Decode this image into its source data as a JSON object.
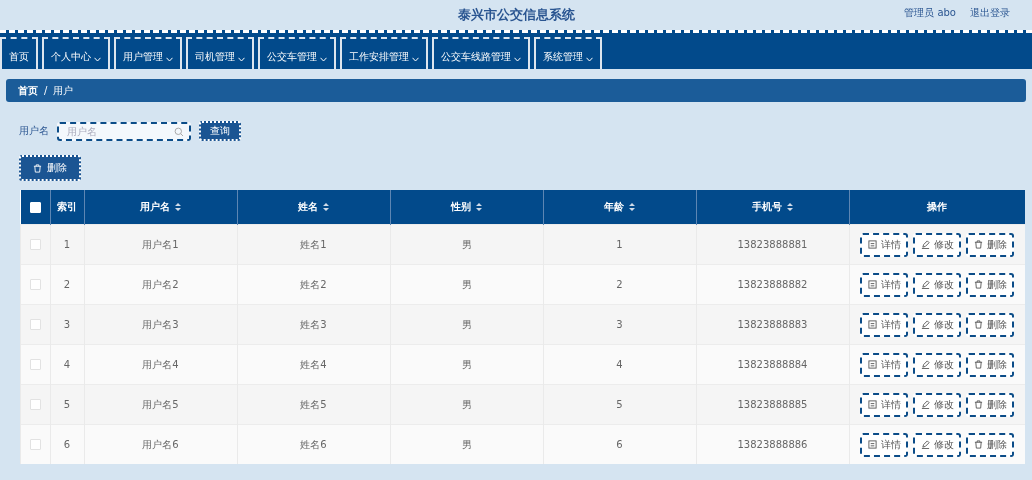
{
  "header": {
    "title": "泰兴市公交信息系统",
    "user": "管理员 abo",
    "logout": "退出登录"
  },
  "nav": [
    {
      "label": "首页",
      "dropdown": false
    },
    {
      "label": "个人中心",
      "dropdown": true
    },
    {
      "label": "用户管理",
      "dropdown": true
    },
    {
      "label": "司机管理",
      "dropdown": true
    },
    {
      "label": "公交车管理",
      "dropdown": true
    },
    {
      "label": "工作安排管理",
      "dropdown": true
    },
    {
      "label": "公交车线路管理",
      "dropdown": true
    },
    {
      "label": "系统管理",
      "dropdown": true
    }
  ],
  "breadcrumb": {
    "items": [
      "首页",
      "用户"
    ],
    "separator": "/"
  },
  "search": {
    "label": "用户名",
    "placeholder": "用户名",
    "button": "查询"
  },
  "delete_button": "删除",
  "table": {
    "select_all_checked": false,
    "columns": [
      {
        "label": "索引",
        "sortable": false
      },
      {
        "label": "用户名",
        "sortable": true
      },
      {
        "label": "姓名",
        "sortable": true
      },
      {
        "label": "性别",
        "sortable": true
      },
      {
        "label": "年龄",
        "sortable": true
      },
      {
        "label": "手机号",
        "sortable": true
      },
      {
        "label": "操作",
        "sortable": false
      }
    ],
    "rows": [
      {
        "checked": false,
        "cells": [
          "1",
          "用户名1",
          "姓名1",
          "男",
          "1",
          "13823888881"
        ],
        "actions": [
          "详情",
          "修改",
          "删除"
        ]
      },
      {
        "checked": false,
        "cells": [
          "2",
          "用户名2",
          "姓名2",
          "男",
          "2",
          "13823888882"
        ],
        "actions": [
          "详情",
          "修改",
          "删除"
        ]
      },
      {
        "checked": false,
        "cells": [
          "3",
          "用户名3",
          "姓名3",
          "男",
          "3",
          "13823888883"
        ],
        "actions": [
          "详情",
          "修改",
          "删除"
        ]
      },
      {
        "checked": false,
        "cells": [
          "4",
          "用户名4",
          "姓名4",
          "男",
          "4",
          "13823888884"
        ],
        "actions": [
          "详情",
          "修改",
          "删除"
        ]
      },
      {
        "checked": false,
        "cells": [
          "5",
          "用户名5",
          "姓名5",
          "男",
          "5",
          "13823888885"
        ],
        "actions": [
          "详情",
          "修改",
          "删除"
        ]
      },
      {
        "checked": false,
        "cells": [
          "6",
          "用户名6",
          "姓名6",
          "男",
          "6",
          "13823888886"
        ],
        "actions": [
          "详情",
          "修改",
          "删除"
        ]
      }
    ]
  }
}
